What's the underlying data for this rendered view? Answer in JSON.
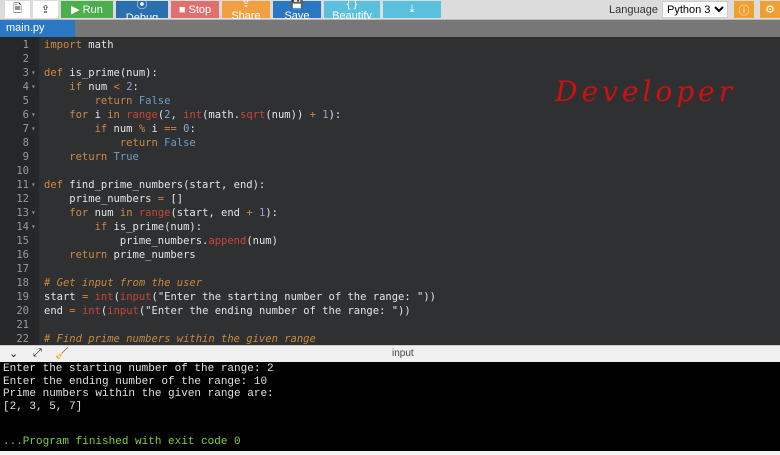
{
  "toolbar": {
    "new_file": "new-file-icon",
    "upload": "upload-icon",
    "run": "▶ Run",
    "debug": "⦿ Debug",
    "stop": "■ Stop",
    "share": "⇪ Share",
    "save": "💾 Save",
    "beautify": "{ } Beautify",
    "download": "⤓"
  },
  "colors": {
    "run": "#4cae4c",
    "debug": "#2a6fb0",
    "stop": "#e07070",
    "share": "#f0a040",
    "save": "#2a78c4",
    "beautify": "#5bc0de",
    "download": "#5bc0de"
  },
  "language": {
    "label": "Language",
    "selected": "Python 3"
  },
  "tab": {
    "name": "main.py"
  },
  "annotation": "Developer",
  "code": [
    {
      "n": "1",
      "f": false,
      "t": [
        [
          "import",
          "kw"
        ],
        [
          " math",
          ""
        ]
      ]
    },
    {
      "n": "2",
      "f": false,
      "t": []
    },
    {
      "n": "3",
      "f": true,
      "t": [
        [
          "def",
          "kw"
        ],
        [
          " is_prime(num):",
          ""
        ]
      ]
    },
    {
      "n": "4",
      "f": true,
      "t": [
        [
          "    if",
          "kw"
        ],
        [
          " num ",
          ""
        ],
        [
          "<",
          "op"
        ],
        [
          " ",
          ""
        ],
        [
          "2",
          "nu"
        ],
        [
          ":",
          ""
        ]
      ]
    },
    {
      "n": "5",
      "f": false,
      "t": [
        [
          "        return",
          "kw"
        ],
        [
          " ",
          ""
        ],
        [
          "False",
          "cn"
        ]
      ]
    },
    {
      "n": "6",
      "f": true,
      "t": [
        [
          "    for",
          "kw"
        ],
        [
          " i ",
          ""
        ],
        [
          "in",
          "kw"
        ],
        [
          " ",
          ""
        ],
        [
          "range",
          "bi"
        ],
        [
          "(",
          ""
        ],
        [
          "2",
          "nu"
        ],
        [
          ", ",
          ""
        ],
        [
          "int",
          "bi"
        ],
        [
          "(math.",
          ""
        ],
        [
          "sqrt",
          "bi"
        ],
        [
          "(num)) ",
          ""
        ],
        [
          "+",
          "op"
        ],
        [
          " ",
          ""
        ],
        [
          "1",
          "nu"
        ],
        [
          "):",
          ""
        ]
      ]
    },
    {
      "n": "7",
      "f": true,
      "t": [
        [
          "        if",
          "kw"
        ],
        [
          " num ",
          ""
        ],
        [
          "%",
          "op"
        ],
        [
          " i ",
          ""
        ],
        [
          "==",
          "op"
        ],
        [
          " ",
          ""
        ],
        [
          "0",
          "nu"
        ],
        [
          ":",
          ""
        ]
      ]
    },
    {
      "n": "8",
      "f": false,
      "t": [
        [
          "            return",
          "kw"
        ],
        [
          " ",
          ""
        ],
        [
          "False",
          "cn"
        ]
      ]
    },
    {
      "n": "9",
      "f": false,
      "t": [
        [
          "    return",
          "kw"
        ],
        [
          " ",
          ""
        ],
        [
          "True",
          "cn"
        ]
      ]
    },
    {
      "n": "10",
      "f": false,
      "t": []
    },
    {
      "n": "11",
      "f": true,
      "t": [
        [
          "def",
          "kw"
        ],
        [
          " find_prime_numbers(start, end):",
          ""
        ]
      ]
    },
    {
      "n": "12",
      "f": false,
      "t": [
        [
          "    prime_numbers ",
          ""
        ],
        [
          "=",
          "op"
        ],
        [
          " []",
          ""
        ]
      ]
    },
    {
      "n": "13",
      "f": true,
      "t": [
        [
          "    for",
          "kw"
        ],
        [
          " num ",
          ""
        ],
        [
          "in",
          "kw"
        ],
        [
          " ",
          ""
        ],
        [
          "range",
          "bi"
        ],
        [
          "(start, end ",
          ""
        ],
        [
          "+",
          "op"
        ],
        [
          " ",
          ""
        ],
        [
          "1",
          "nu"
        ],
        [
          "):",
          ""
        ]
      ]
    },
    {
      "n": "14",
      "f": true,
      "t": [
        [
          "        if",
          "kw"
        ],
        [
          " is_prime(num):",
          ""
        ]
      ]
    },
    {
      "n": "15",
      "f": false,
      "t": [
        [
          "            prime_numbers.",
          ""
        ],
        [
          "append",
          "bi"
        ],
        [
          "(num)",
          ""
        ]
      ]
    },
    {
      "n": "16",
      "f": false,
      "t": [
        [
          "    return",
          "kw"
        ],
        [
          " prime_numbers",
          ""
        ]
      ]
    },
    {
      "n": "17",
      "f": false,
      "t": []
    },
    {
      "n": "18",
      "f": false,
      "t": [
        [
          "# Get input from the user",
          "cm"
        ]
      ]
    },
    {
      "n": "19",
      "f": false,
      "t": [
        [
          "start ",
          ""
        ],
        [
          "=",
          "op"
        ],
        [
          " ",
          ""
        ],
        [
          "int",
          "bi"
        ],
        [
          "(",
          ""
        ],
        [
          "input",
          "bi"
        ],
        [
          "(\"Enter the starting number of the range: \"))",
          ""
        ]
      ]
    },
    {
      "n": "20",
      "f": false,
      "t": [
        [
          "end ",
          ""
        ],
        [
          "=",
          "op"
        ],
        [
          " ",
          ""
        ],
        [
          "int",
          "bi"
        ],
        [
          "(",
          ""
        ],
        [
          "input",
          "bi"
        ],
        [
          "(\"Enter the ending number of the range: \"))",
          ""
        ]
      ]
    },
    {
      "n": "21",
      "f": false,
      "t": []
    },
    {
      "n": "22",
      "f": false,
      "t": [
        [
          "# Find prime numbers within the given range",
          "cm"
        ]
      ]
    }
  ],
  "io": {
    "label": "input"
  },
  "console": {
    "lines": [
      "Enter the starting number of the range: 2",
      "Enter the ending number of the range: 10",
      "Prime numbers within the given range are:",
      "[2, 3, 5, 7]"
    ],
    "exit": "...Program finished with exit code 0"
  }
}
